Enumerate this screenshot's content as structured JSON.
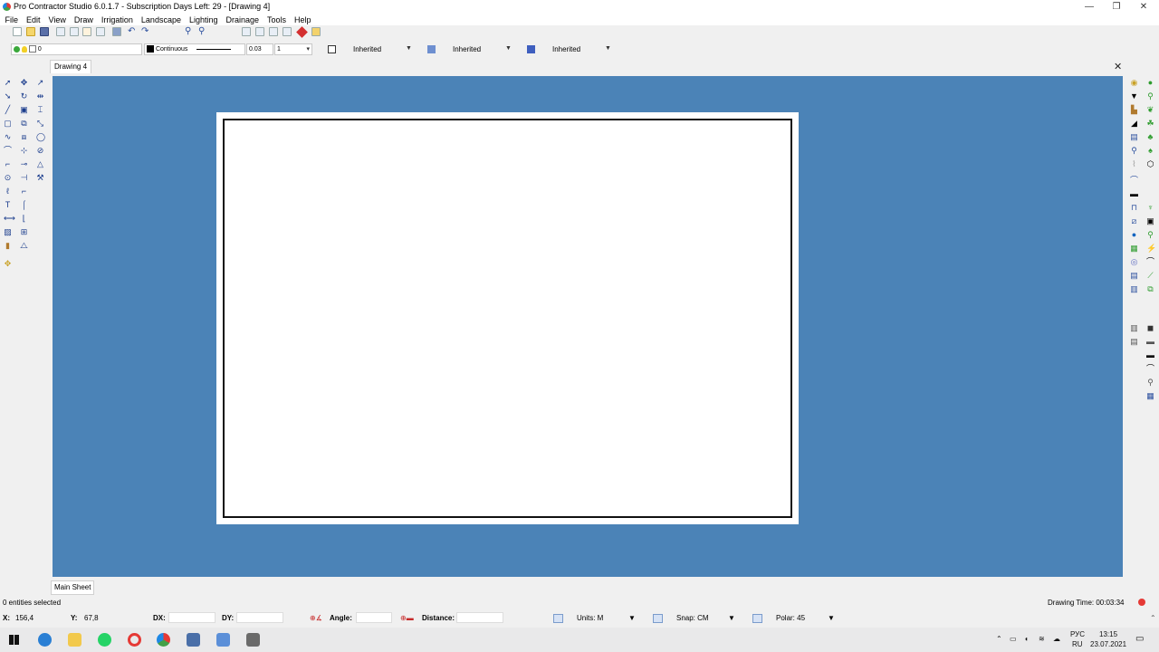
{
  "window": {
    "title": "Pro Contractor Studio 6.0.1.7 - Subscription Days Left: 29 - [Drawing 4]",
    "minimize_icon": "—",
    "restore_icon": "❐",
    "close_icon": "✕"
  },
  "menu": [
    "File",
    "Edit",
    "View",
    "Draw",
    "Irrigation",
    "Landscape",
    "Lighting",
    "Drainage",
    "Tools",
    "Help"
  ],
  "properties": {
    "layer_value": "0",
    "linetype": "Continuous",
    "lineweight": "0.03",
    "scale": "1",
    "fill_color": "Inherited",
    "hatch": "Inherited",
    "fill_style": "Inherited"
  },
  "tabs": {
    "drawing": "Drawing 4",
    "close": "✕",
    "sheet": "Main Sheet"
  },
  "status": {
    "selection": "0 entities selected",
    "drawing_time_label": "Drawing Time: 00:03:34"
  },
  "coords": {
    "x_label": "X:",
    "x_value": "156,4",
    "y_label": "Y:",
    "y_value": "67,8",
    "dx_label": "DX:",
    "dy_label": "DY:",
    "angle_label": "Angle:",
    "distance_label": "Distance:",
    "units": "Units: M",
    "snap": "Snap: CM",
    "polar": "Polar: 45"
  },
  "taskbar": {
    "lang_top": "РУС",
    "lang_bottom": "RU",
    "time": "13:15",
    "date": "23.07.2021"
  },
  "colors": {
    "canvas": "#4b83b7",
    "paper": "#ffffff"
  }
}
